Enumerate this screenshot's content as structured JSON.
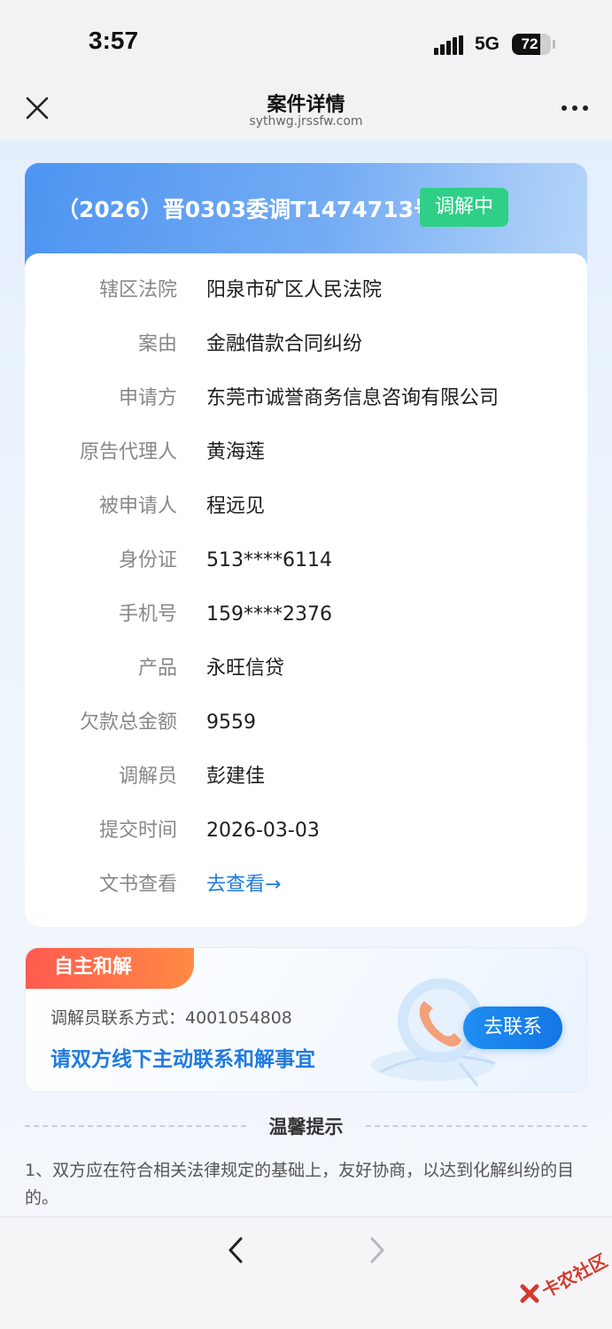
{
  "status_bar": {
    "time": "3:57",
    "network": "5G",
    "battery": "72"
  },
  "header": {
    "title": "案件详情",
    "url": "sythwg.jrssfw.com"
  },
  "case": {
    "case_number": "（2026）晋0303委调T1474713号",
    "status": "调解中",
    "fields": [
      {
        "label": "辖区法院",
        "value": "阳泉市矿区人民法院"
      },
      {
        "label": "案由",
        "value": "金融借款合同纠纷"
      },
      {
        "label": "申请方",
        "value": "东莞市诚誉商务信息咨询有限公司"
      },
      {
        "label": "原告代理人",
        "value": "黄海莲"
      },
      {
        "label": "被申请人",
        "value": "程远见"
      },
      {
        "label": "身份证",
        "value": "513****6114"
      },
      {
        "label": "手机号",
        "value": "159****2376"
      },
      {
        "label": "产品",
        "value": "永旺信贷"
      },
      {
        "label": "欠款总金额",
        "value": "9559"
      },
      {
        "label": "调解员",
        "value": "彭建佳"
      },
      {
        "label": "提交时间",
        "value": "2026-03-03"
      },
      {
        "label": "文书查看",
        "value": "去查看→"
      }
    ]
  },
  "mediation": {
    "tag": "自主和解",
    "contact_line": "调解员联系方式：4001054808",
    "hint": "请双方线下主动联系和解事宜",
    "button": "去联系"
  },
  "tips": {
    "title": "温馨提示",
    "text": "1、双方应在符合相关法律规定的基础上，友好协商，以达到化解纠纷的目的。"
  },
  "watermark": "卡农社区",
  "colors": {
    "accent_blue": "#1f7ae0",
    "status_green": "#2fcf88",
    "tag_orange": "#ff6a4a"
  }
}
